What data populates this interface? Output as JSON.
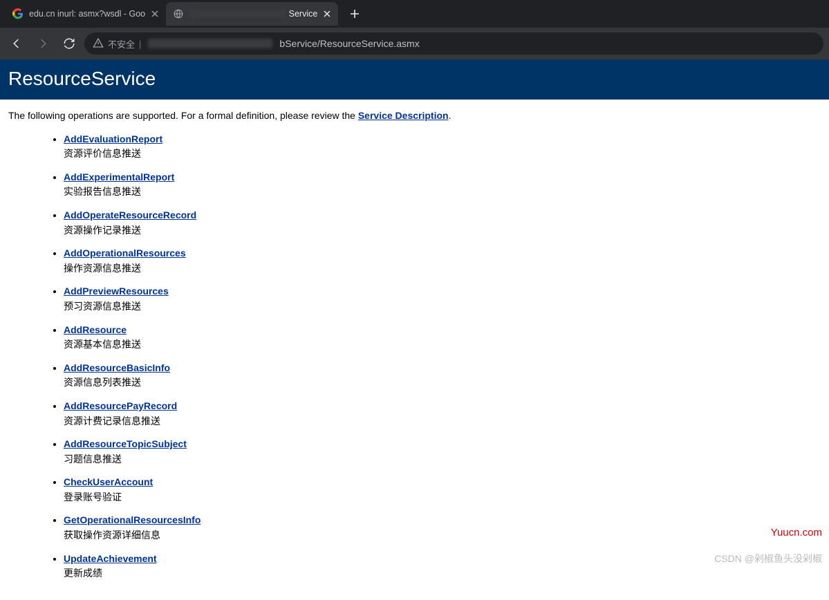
{
  "browser": {
    "tabs": [
      {
        "title": "edu.cn inurl: asmx?wsdl - Goo",
        "active": false,
        "favicon": "google"
      },
      {
        "title": "Service",
        "title_suffix_only": true,
        "active": true,
        "favicon": "globe"
      }
    ],
    "security_label": "不安全",
    "url_visible_suffix": "bService/ResourceService.asmx"
  },
  "page": {
    "title": "ResourceService",
    "intro_prefix": "The following operations are supported. For a formal definition, please review the ",
    "service_description_link": "Service Description",
    "intro_suffix": ".",
    "operations": [
      {
        "name": "AddEvaluationReport",
        "desc": "资源评价信息推送"
      },
      {
        "name": "AddExperimentalReport",
        "desc": "实验报告信息推送"
      },
      {
        "name": "AddOperateResourceRecord",
        "desc": "资源操作记录推送"
      },
      {
        "name": "AddOperationalResources",
        "desc": "操作资源信息推送"
      },
      {
        "name": "AddPreviewResources",
        "desc": "预习资源信息推送"
      },
      {
        "name": "AddResource",
        "desc": "资源基本信息推送"
      },
      {
        "name": "AddResourceBasicInfo",
        "desc": "资源信息列表推送"
      },
      {
        "name": "AddResourcePayRecord",
        "desc": "资源计费记录信息推送"
      },
      {
        "name": "AddResourceTopicSubject",
        "desc": "习题信息推送"
      },
      {
        "name": "CheckUserAccount",
        "desc": "登录账号验证"
      },
      {
        "name": "GetOperationalResourcesInfo",
        "desc": "获取操作资源详细信息"
      },
      {
        "name": "UpdateAchievement",
        "desc": "更新成绩"
      }
    ]
  },
  "watermarks": {
    "top_right": "Yuucn.com",
    "bottom_right": "CSDN @剁椒鱼头没剁椒"
  }
}
